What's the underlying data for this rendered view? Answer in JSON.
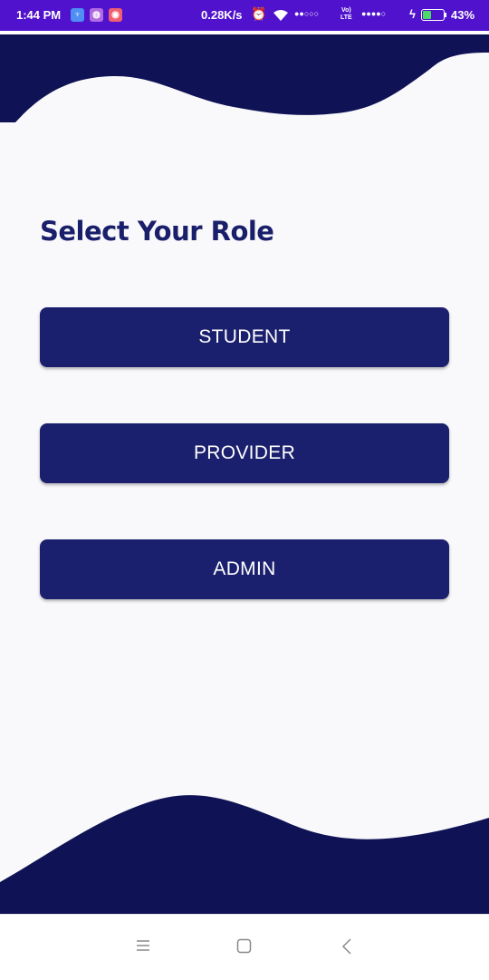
{
  "status_bar": {
    "time": "1:44 PM",
    "notification_icons": [
      {
        "icon": "settings-app-icon",
        "color": "#4d8ff5",
        "glyph": "♆"
      },
      {
        "icon": "app-icon",
        "color": "#b06be0",
        "glyph": "◍"
      },
      {
        "icon": "app-icon",
        "color": "#ef5f6f",
        "glyph": "◉"
      }
    ],
    "network_speed": "0.28K/s",
    "alarm_icon": "alarm-icon",
    "wifi_icon": "wifi-icon",
    "signal_1": "●●○○○",
    "lte_label_top": "Vo)",
    "lte_label_bottom": "LTE",
    "signal_2": "●●●●○",
    "battery_percent": "43%",
    "battery_level": 0.43,
    "colors": {
      "background": "#5012cc"
    }
  },
  "header": {
    "title": "Select Your Role"
  },
  "roles": [
    {
      "label": "STUDENT"
    },
    {
      "label": "PROVIDER"
    },
    {
      "label": "ADMIN"
    }
  ],
  "nav_bar": {
    "menu_icon": "menu-icon",
    "home_icon": "home-square-icon",
    "back_icon": "back-chevron-icon"
  },
  "colors": {
    "brand_dark": "#0f1255",
    "button": "#1b206e",
    "title": "#1a1f6b",
    "background": "#f9f9fb"
  }
}
